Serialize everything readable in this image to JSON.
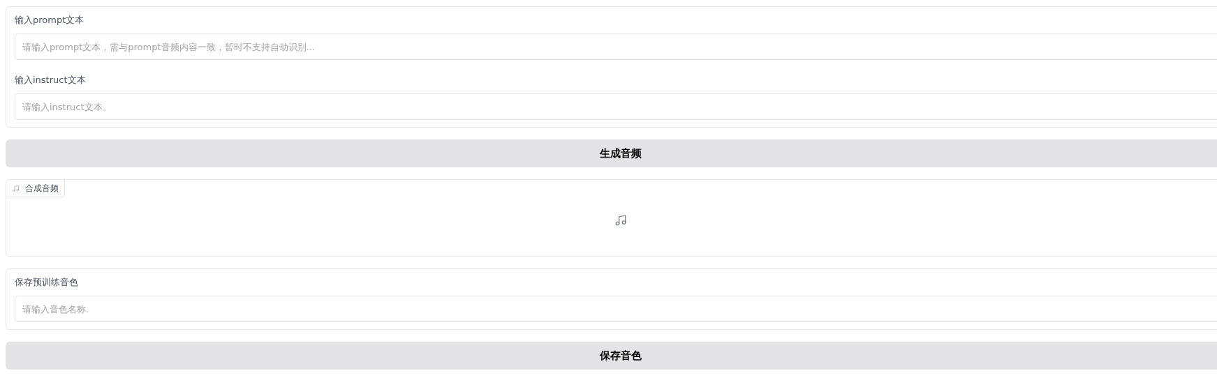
{
  "prompt_text": {
    "label": "输入prompt文本",
    "placeholder": "请输入prompt文本，需与prompt音频内容一致，暂时不支持自动识别..."
  },
  "instruct_text": {
    "label": "输入instruct文本",
    "placeholder": "请输入instruct文本。"
  },
  "generate_button": "生成音频",
  "output_audio": {
    "label": "合成音频"
  },
  "save_voice": {
    "label": "保存预训练音色",
    "placeholder": "请输入音色名称."
  },
  "save_button": "保存音色"
}
